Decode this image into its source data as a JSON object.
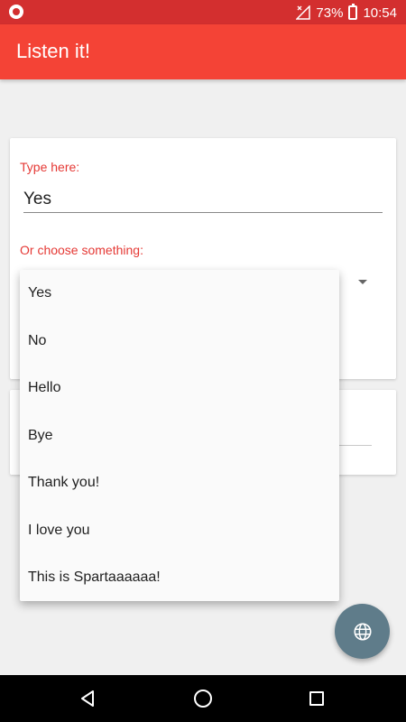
{
  "status_bar": {
    "battery_percent": "73%",
    "time": "10:54",
    "icons": [
      "recording-icon",
      "no-signal-icon",
      "battery-charging-icon"
    ]
  },
  "app_bar": {
    "title": "Listen it!"
  },
  "form": {
    "type_label": "Type here:",
    "input_value": "Yes",
    "choose_label": "Or choose something:"
  },
  "dropdown": {
    "options": [
      "Yes",
      "No",
      "Hello",
      "Bye",
      "Thank you!",
      "I love you",
      "This is Spartaaaaaa!"
    ]
  },
  "fab": {
    "icon": "globe-icon"
  },
  "nav": {
    "icons": [
      "back-icon",
      "home-icon",
      "recents-icon"
    ]
  },
  "colors": {
    "app_bar": "#f44336",
    "status_bar": "#d32f2f",
    "accent_label": "#e53935",
    "fab": "#5f7c8a"
  }
}
